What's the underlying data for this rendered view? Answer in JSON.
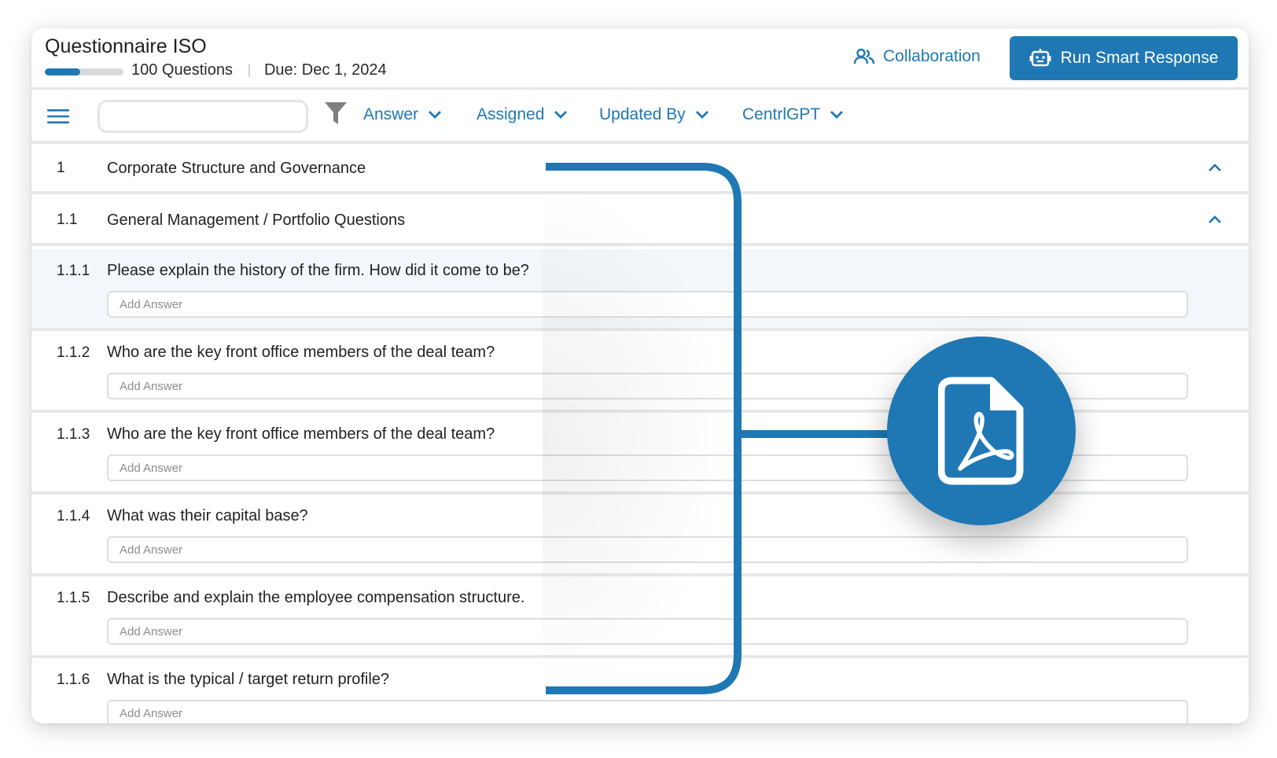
{
  "header": {
    "title": "Questionnaire ISO",
    "progress_percent": 45,
    "question_count": "100 Questions",
    "due": "Due: Dec 1, 2024",
    "collaboration_label": "Collaboration",
    "run_label": "Run Smart Response"
  },
  "toolbar": {
    "search_value": "",
    "dropdowns": [
      "Answer",
      "Assigned",
      "Updated By",
      "CentrlGPT"
    ]
  },
  "sections": [
    {
      "num": "1",
      "title": "Corporate Structure and Governance"
    },
    {
      "num": "1.1",
      "title": "General Management / Portfolio Questions"
    }
  ],
  "questions": [
    {
      "num": "1.1.1",
      "text": "Please explain the history of the firm. How did it come to be?",
      "placeholder": "Add Answer"
    },
    {
      "num": "1.1.2",
      "text": "Who are the key front office members of the deal team?",
      "placeholder": "Add Answer"
    },
    {
      "num": "1.1.3",
      "text": "Who are the key front office members of the deal team?",
      "placeholder": "Add Answer"
    },
    {
      "num": "1.1.4",
      "text": "What was their capital base?",
      "placeholder": "Add Answer"
    },
    {
      "num": "1.1.5",
      "text": "Describe and explain the employee compensation structure.",
      "placeholder": "Add Answer"
    },
    {
      "num": "1.1.6",
      "text": "What is the typical / target return profile?",
      "placeholder": "Add Answer"
    }
  ],
  "colors": {
    "accent": "#1f78b4",
    "divider": "#e6e8ea",
    "active_row": "#f3f7fb"
  },
  "icons": [
    "people-icon",
    "robot-icon",
    "hamburger-menu-icon",
    "filter-icon",
    "chevron-down-icon",
    "chevron-up-icon",
    "pdf-file-icon"
  ]
}
